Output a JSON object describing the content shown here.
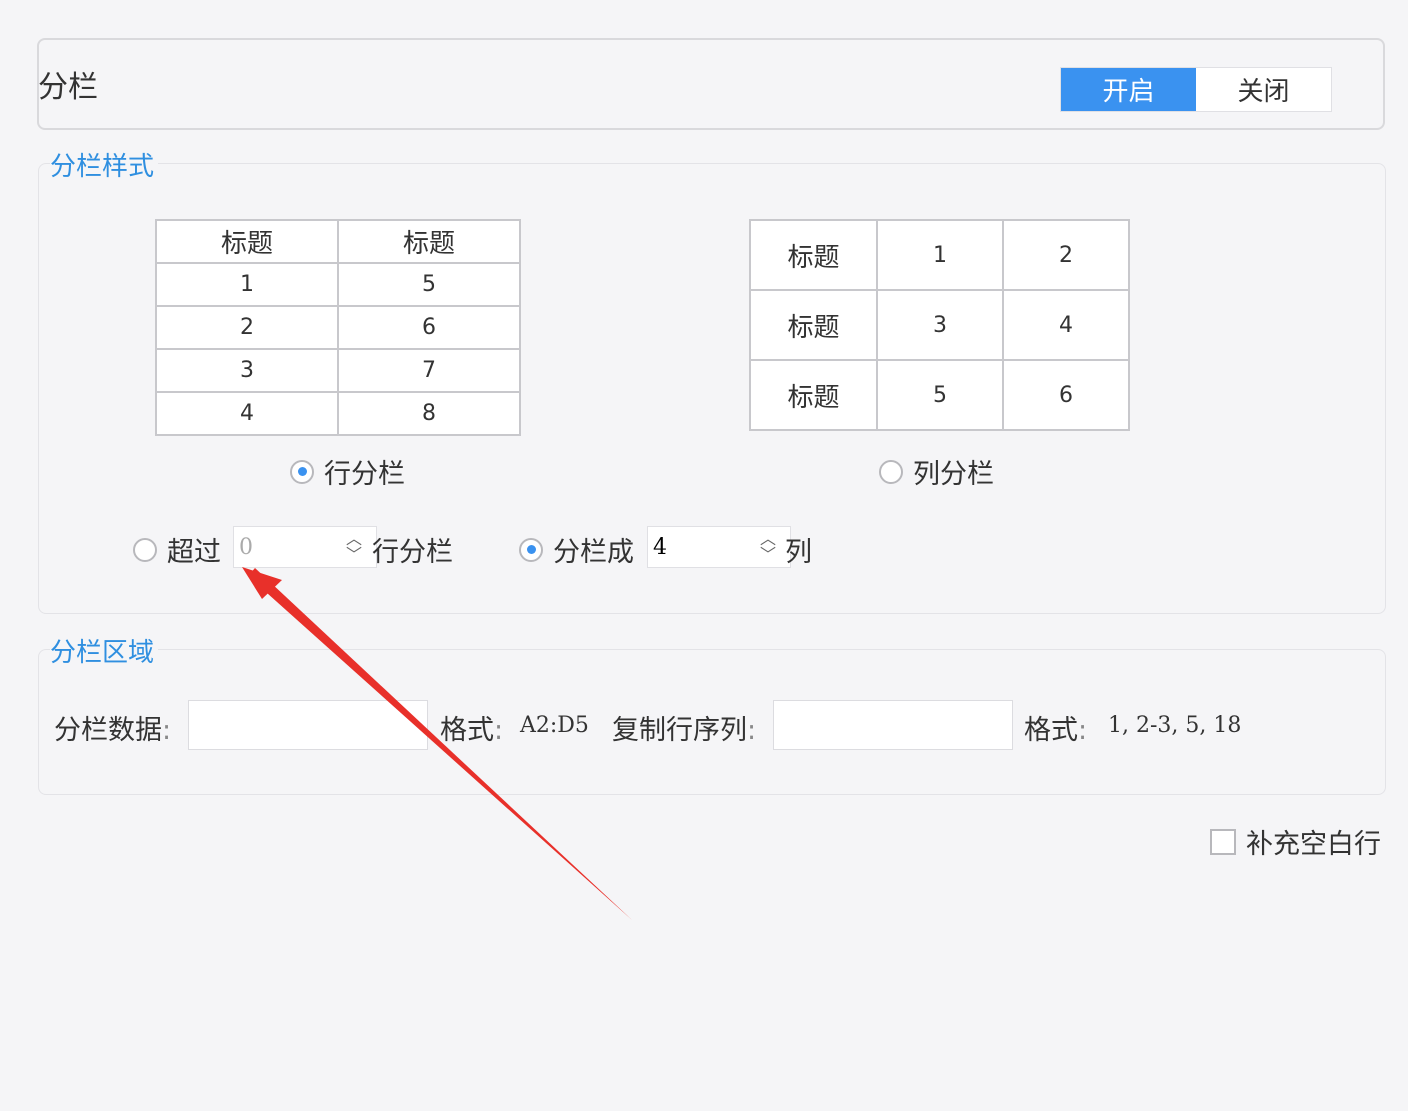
{
  "column": {
    "title": "分栏",
    "toggle_on": "开启",
    "toggle_off": "关闭"
  },
  "style_group": {
    "legend": "分栏样式",
    "row_example": {
      "headers": [
        "标题",
        "标题"
      ],
      "rows": [
        [
          "1",
          "5"
        ],
        [
          "2",
          "6"
        ],
        [
          "3",
          "7"
        ],
        [
          "4",
          "8"
        ]
      ]
    },
    "col_example": {
      "rows": [
        [
          "标题",
          "1",
          "2"
        ],
        [
          "标题",
          "3",
          "4"
        ],
        [
          "标题",
          "5",
          "6"
        ]
      ]
    },
    "row_option": "行分栏",
    "col_option": "列分栏",
    "exceed_label": "超过",
    "exceed_value": "0",
    "exceed_suffix": "行分栏",
    "split_label": "分栏成",
    "split_value": "4",
    "split_suffix": "列"
  },
  "region_group": {
    "legend": "分栏区域",
    "data_label": "分栏数据",
    "data_colon": ":",
    "format_label": "格式",
    "format_colon": ":",
    "format_value": "A2:D5",
    "copy_label": "复制行序列",
    "copy_colon": ":",
    "copy_format_label": "格式",
    "copy_format_colon": ":",
    "copy_format_value": "1, 2-3, 5, 18"
  },
  "fill_blank": "补充空白行",
  "colors": {
    "accent": "#3a92f0",
    "legend": "#2f8fe0",
    "arrow": "#e8302a"
  }
}
